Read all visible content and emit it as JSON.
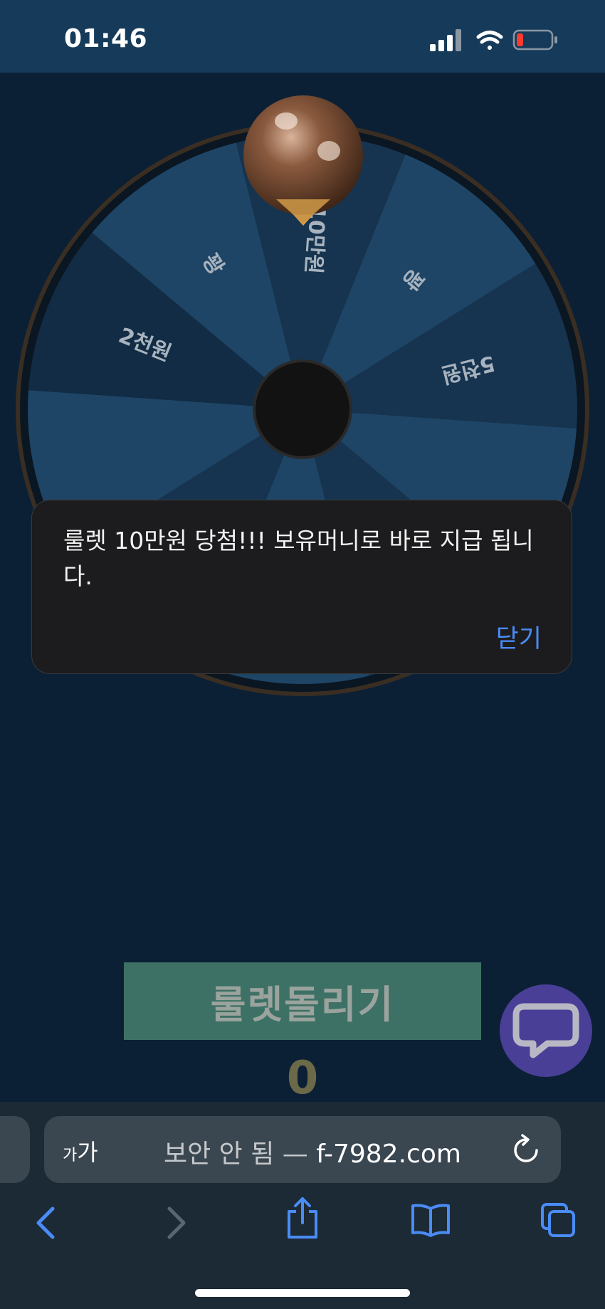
{
  "status": {
    "time": "01:46",
    "icons": [
      "cellular-signal-icon",
      "wifi-icon",
      "battery-low-icon"
    ]
  },
  "roulette": {
    "segments": [
      {
        "label": "10만원",
        "color": "#16344f"
      },
      {
        "label": "꽝",
        "color": "#1e4566"
      },
      {
        "label": "5천원",
        "color": "#16344f"
      },
      {
        "label": "",
        "color": "#1e4566"
      },
      {
        "label": "",
        "color": "#16344f"
      },
      {
        "label": "",
        "color": "#1e4566"
      },
      {
        "label": "",
        "color": "#16344f"
      },
      {
        "label": "",
        "color": "#1e4566"
      },
      {
        "label": "2천원",
        "color": "#112c44"
      },
      {
        "label": "꽝",
        "color": "#1e4566"
      }
    ],
    "spin_button_label": "룰렛돌리기",
    "spin_count": "0"
  },
  "dialog": {
    "message": "룰렛 10만원 당첨!!! 보유머니로 바로 지급 됩니다.",
    "close_label": "닫기"
  },
  "browser": {
    "text_size_small": "가",
    "text_size_large": "가",
    "security_label": "보안 안 됨 —",
    "domain": "f-7982.com"
  },
  "colors": {
    "background": "#0b2035",
    "accent_link": "#4a8cf7",
    "spin_button": "#3e7165",
    "chat_button": "#4a3f97"
  }
}
